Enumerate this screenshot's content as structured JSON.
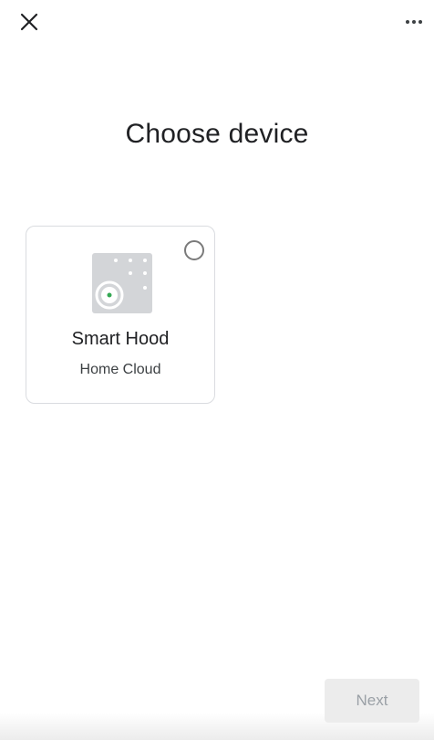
{
  "header": {
    "close_icon": "close-icon",
    "more_icon": "more-horizontal-icon"
  },
  "page": {
    "title": "Choose device"
  },
  "devices": [
    {
      "name": "Smart Hood",
      "vendor": "Home Cloud",
      "image_icon": "smart-hood-icon",
      "selected": false
    }
  ],
  "footer": {
    "next_label": "Next",
    "next_enabled": false
  },
  "colors": {
    "status_dot": "#34a853",
    "device_panel": "#d3d5d8",
    "card_border": "#dadce0",
    "disabled_button_bg": "#ececec",
    "disabled_button_text": "#9aa0a6"
  }
}
